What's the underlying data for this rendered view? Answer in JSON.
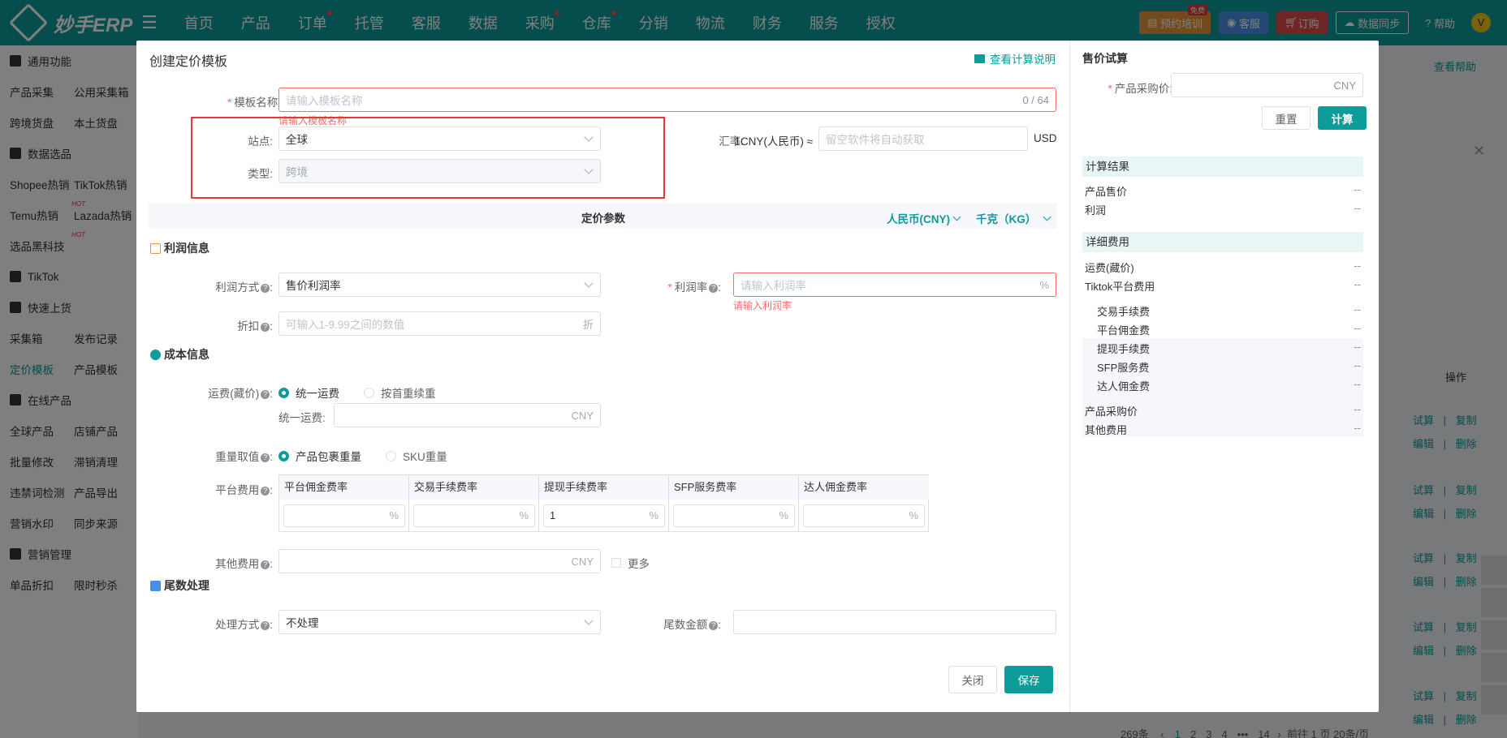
{
  "app": {
    "logo": "妙手ERP",
    "menu_icon": "menu-icon"
  },
  "nav": [
    {
      "label": "首页",
      "dot": false
    },
    {
      "label": "产品",
      "dot": false
    },
    {
      "label": "订单",
      "dot": true
    },
    {
      "label": "托管",
      "dot": false
    },
    {
      "label": "客服",
      "dot": false
    },
    {
      "label": "数据",
      "dot": false
    },
    {
      "label": "采购",
      "dot": true
    },
    {
      "label": "仓库",
      "dot": true
    },
    {
      "label": "分销",
      "dot": false
    },
    {
      "label": "物流",
      "dot": false
    },
    {
      "label": "财务",
      "dot": false
    },
    {
      "label": "服务",
      "dot": false
    },
    {
      "label": "授权",
      "dot": false
    }
  ],
  "topright": {
    "training": "预约培训",
    "training_badge": "免费",
    "service": "客服",
    "order": "订购",
    "sync": "数据同步",
    "help": "帮助",
    "avatar": "V"
  },
  "colors": {
    "brand": "#0c9c9a",
    "error": "#f56c6c",
    "training": "#e6953d",
    "order": "#e04a4a",
    "service": "#4a8ee6"
  },
  "sidebar": {
    "groups": [
      {
        "head": "通用功能",
        "rows": [
          [
            "产品采集",
            "公用采集箱"
          ],
          [
            "跨境货盘",
            "本土货盘"
          ]
        ]
      },
      {
        "head": "数据选品",
        "rows": [
          [
            "Shopee热销",
            "TikTok热销"
          ],
          [
            "Temu热销",
            "Lazada热销"
          ],
          [
            "选品黑科技",
            ""
          ]
        ]
      },
      {
        "head": "TikTok",
        "rows": []
      },
      {
        "head": "快速上货",
        "rows": [
          [
            "采集箱",
            "发布记录"
          ],
          [
            "定价模板",
            "产品模板"
          ]
        ]
      },
      {
        "head": "在线产品",
        "rows": [
          [
            "全球产品",
            "店铺产品"
          ],
          [
            "批量修改",
            "滞销清理"
          ],
          [
            "违禁词检测",
            "产品导出"
          ],
          [
            "营销水印",
            "同步来源"
          ]
        ]
      },
      {
        "head": "营销管理",
        "rows": [
          [
            "单品折扣",
            "限时秒杀"
          ]
        ]
      }
    ]
  },
  "background": {
    "help": "查看帮助",
    "op_header": "操作",
    "actions": [
      [
        "试算",
        "复制"
      ],
      [
        "编辑",
        "删除"
      ]
    ],
    "pager": {
      "total": "269条",
      "pages": [
        "1",
        "2",
        "3",
        "4",
        "•••",
        "14"
      ],
      "goto": "前往",
      "goto_val": "1",
      "page_unit": "页",
      "per_page": "20条/页"
    }
  },
  "modal": {
    "title": "创建定价模板",
    "explain_link": "查看计算说明",
    "name": {
      "label": "模板名称:",
      "placeholder": "请输入模板名称",
      "count": "0 / 64",
      "error": "请输入模板名称"
    },
    "site": {
      "label": "站点:",
      "value": "全球"
    },
    "type": {
      "label": "类型:",
      "value": "跨境"
    },
    "rate": {
      "label": "汇率:",
      "prefix": "1CNY(人民币) ≈",
      "placeholder": "留空软件将自动获取",
      "suffix": "USD"
    },
    "params_title": "定价参数",
    "currency": "人民币(CNY)",
    "unit": "千克（KG）",
    "profit_section": "利润信息",
    "profit_method": {
      "label": "利润方式",
      "value": "售价利润率"
    },
    "profit_rate": {
      "label": "利润率",
      "placeholder": "请输入利润率",
      "suffix": "%",
      "error": "请输入利润率"
    },
    "discount": {
      "label": "折扣",
      "placeholder": "可输入1-9.99之间的数值",
      "suffix": "折"
    },
    "cost_section": "成本信息",
    "shipping": {
      "label": "运费(藏价)",
      "opt1": "统一运费",
      "opt2": "按首重续重",
      "sub_label": "统一运费:",
      "suffix": "CNY"
    },
    "weight": {
      "label": "重量取值",
      "opt1": "产品包裹重量",
      "opt2": "SKU重量"
    },
    "platform_fee": {
      "label": "平台费用",
      "cols": [
        {
          "h": "平台佣金费率",
          "v": ""
        },
        {
          "h": "交易手续费率",
          "v": ""
        },
        {
          "h": "提现手续费率",
          "v": "1"
        },
        {
          "h": "SFP服务费率",
          "v": ""
        },
        {
          "h": "达人佣金费率",
          "v": ""
        }
      ],
      "suffix": "%"
    },
    "other_fee": {
      "label": "其他费用",
      "suffix": "CNY",
      "more": "更多"
    },
    "tail_section": "尾数处理",
    "tail_method": {
      "label": "处理方式",
      "value": "不处理"
    },
    "tail_amount": {
      "label": "尾数金额"
    },
    "close_btn": "关闭",
    "save_btn": "保存"
  },
  "trial": {
    "title": "售价试算",
    "cost_label": "产品采购价:",
    "cost_suffix": "CNY",
    "reset": "重置",
    "calc": "计算",
    "result_title": "计算结果",
    "results": [
      {
        "k": "产品售价",
        "v": "--"
      },
      {
        "k": "利润",
        "v": "--"
      }
    ],
    "detail_title": "详细费用",
    "details": [
      {
        "k": "运费(藏价)",
        "v": "--"
      },
      {
        "k": "Tiktok平台费用",
        "v": "--"
      }
    ],
    "sub": [
      {
        "k": "交易手续费",
        "v": "--"
      },
      {
        "k": "平台佣金费",
        "v": "--"
      },
      {
        "k": "提现手续费",
        "v": "--"
      },
      {
        "k": "SFP服务费",
        "v": "--"
      },
      {
        "k": "达人佣金费",
        "v": "--"
      }
    ],
    "tail": [
      {
        "k": "产品采购价",
        "v": "--"
      },
      {
        "k": "其他费用",
        "v": "--"
      }
    ]
  }
}
